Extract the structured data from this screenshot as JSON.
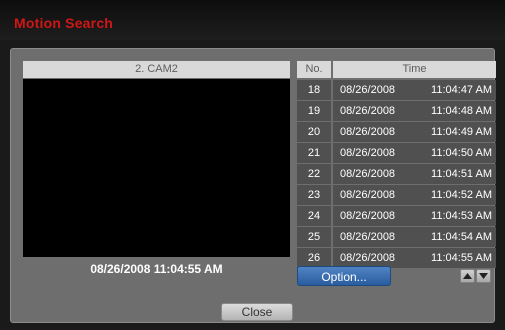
{
  "window": {
    "title": "Motion Search"
  },
  "camera": {
    "header": "2. CAM2",
    "timestamp": "08/26/2008  11:04:55 AM"
  },
  "table": {
    "headers": {
      "no": "No.",
      "time": "Time"
    },
    "rows": [
      {
        "no": "18",
        "date": "08/26/2008",
        "time": "11:04:47 AM"
      },
      {
        "no": "19",
        "date": "08/26/2008",
        "time": "11:04:48 AM"
      },
      {
        "no": "20",
        "date": "08/26/2008",
        "time": "11:04:49 AM"
      },
      {
        "no": "21",
        "date": "08/26/2008",
        "time": "11:04:50 AM"
      },
      {
        "no": "22",
        "date": "08/26/2008",
        "time": "11:04:51 AM"
      },
      {
        "no": "23",
        "date": "08/26/2008",
        "time": "11:04:52 AM"
      },
      {
        "no": "24",
        "date": "08/26/2008",
        "time": "11:04:53 AM"
      },
      {
        "no": "25",
        "date": "08/26/2008",
        "time": "11:04:54 AM"
      },
      {
        "no": "26",
        "date": "08/26/2008",
        "time": "11:04:55 AM"
      }
    ]
  },
  "buttons": {
    "option": "Option...",
    "close": "Close",
    "scroll_up_icon": "triangle-up-icon",
    "scroll_down_icon": "triangle-down-icon"
  },
  "colors": {
    "title": "#d11616",
    "option_button": "#2a5d9e"
  }
}
